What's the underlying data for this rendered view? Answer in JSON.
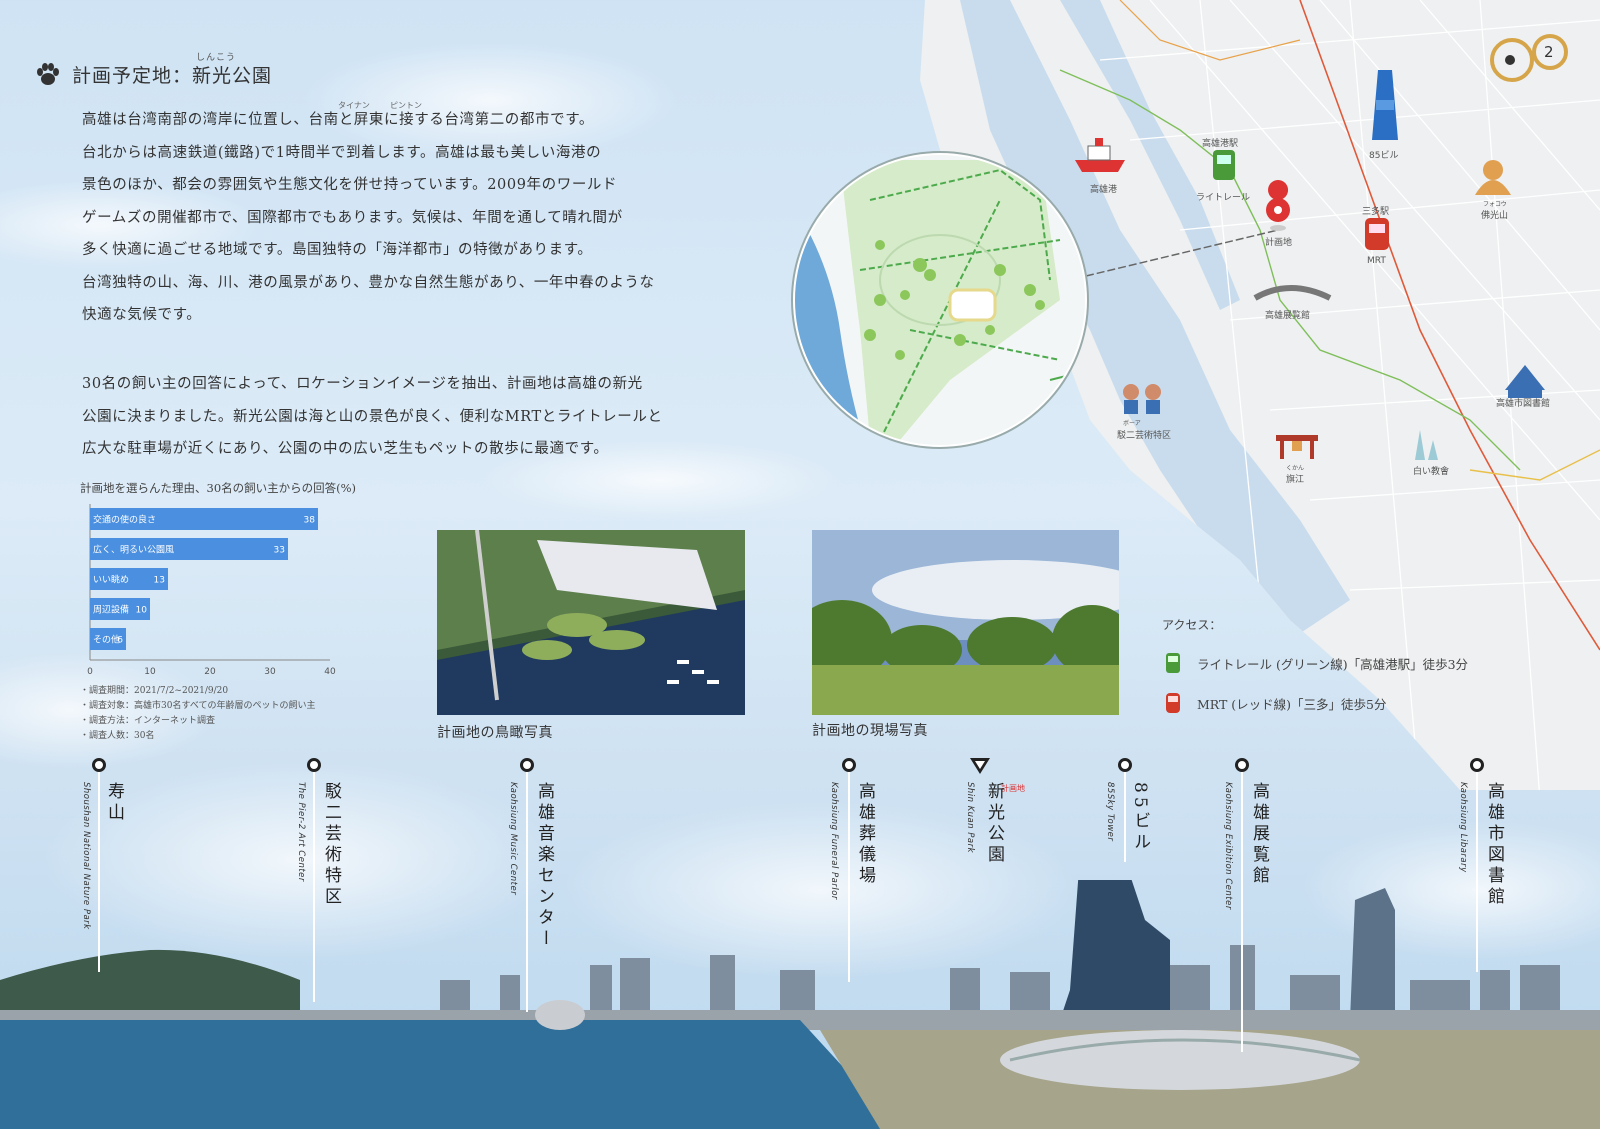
{
  "header": {
    "title": "計画予定地：新光公園",
    "ruby": "しんこう"
  },
  "intro": {
    "paragraph": [
      "高雄は台湾南部の湾岸に位置し、台南と屏東に接する台湾第二の都市です。",
      "台北からは高速鉄道(鐵路)で1時間半で到着します。高雄は最も美しい海港の",
      "景色のほか、都会の雰囲気や生態文化を併せ持っています。2009年のワールド",
      "ゲームズの開催都市で、国際都市でもあります。気候は、年間を通して晴れ間が",
      "多く快適に過ごせる地域です。島国独特の「海洋都市」の特徴があります。",
      "台湾独特の山、海、川、港の風景があり、豊かな自然生態があり、一年中春のような",
      "快適な気候です。"
    ],
    "ruby_tainan": "タイナン",
    "ruby_pingtung": "ピントン"
  },
  "reason": {
    "paragraph": [
      "30名の飼い主の回答によって、ロケーションイメージを抽出、計画地は高雄の新光",
      "公園に決まりました。新光公園は海と山の景色が良く、便利なMRTとライトレールと",
      "広大な駐車場が近くにあり、公園の中の広い芝生もペットの散歩に最適です。"
    ]
  },
  "chart_data": {
    "type": "bar",
    "orientation": "horizontal",
    "title": "計画地を選らんた理由、30名の飼い主からの回答(%)",
    "categories": [
      "交通の使の良さ",
      "広く、明るい公園風",
      "いい眺め",
      "周辺設備",
      "その他"
    ],
    "values": [
      38,
      33,
      13,
      10,
      6
    ],
    "xticks": [
      0,
      10,
      20,
      30,
      40
    ],
    "xlim": [
      0,
      40
    ],
    "color": "#4a8fe0"
  },
  "survey_notes": [
    "・調査期間：2021/7/2~2021/9/20",
    "・調査対象：高雄市30名すべての年齢層のペットの飼い主",
    "・調査方法：インターネット調査",
    "・調査人数：30名"
  ],
  "photos": {
    "aerial_caption": "計画地の鳥瞰写真",
    "site_caption": "計画地の現場写真"
  },
  "map": {
    "labels": {
      "kaohsiung_port": "高雄港",
      "port_station": "高雄港駅",
      "light_rail": "ライトレール",
      "site": "計画地",
      "sanduo": "三多駅",
      "mrt": "MRT",
      "tower": "85ビル",
      "foguang": "佛光山",
      "foguang_ruby": "フォコウ",
      "exhibition": "高雄展覧館",
      "library": "高雄市図書館",
      "pier2": "駁二芸術特区",
      "pier2_ruby": "ボーア",
      "cijin": "旗江",
      "cijin_ruby": "くかん",
      "church": "白い教會"
    },
    "logo_number": "2"
  },
  "access": {
    "title": "アクセス：",
    "items": [
      {
        "text": "ライトレール (グリーン線)「高雄港駅」徒歩3分",
        "icon": "tram-icon",
        "color": "#4a9a3a"
      },
      {
        "text": "MRT (レッド線)「三多」徒歩5分",
        "icon": "train-icon",
        "color": "#d23a2a"
      }
    ]
  },
  "landmarks": [
    {
      "jp": "寿山",
      "en": "Shoushan National Nature Park"
    },
    {
      "jp": "駁二芸術特区",
      "en": "The Pier-2 Art Center"
    },
    {
      "jp": "高雄音楽センター",
      "en": "Kaohsiung Music Center"
    },
    {
      "jp": "高雄葬儀場",
      "en": "Kaohsiung Funeral Parlor"
    },
    {
      "jp": "新光公園",
      "en": "Shin Kuan Park",
      "tag": "計画地"
    },
    {
      "jp": "85ビル",
      "en": "85Sky Tower"
    },
    {
      "jp": "高雄展覧館",
      "en": "Kaohsiung Exibition Center"
    },
    {
      "jp": "高雄市図書館",
      "en": "Kaohsiung Libarary"
    }
  ]
}
